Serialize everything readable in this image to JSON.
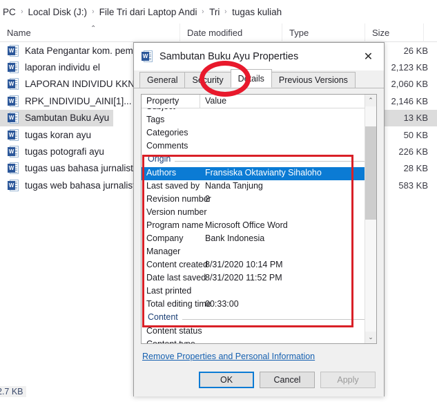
{
  "explorer": {
    "breadcrumb": {
      "items": [
        "PC",
        "Local Disk (J:)",
        "File Tri dari Laptop Andi",
        "Tri",
        "tugas kuliah"
      ],
      "separator": "›"
    },
    "columns": [
      {
        "label": "Name",
        "sort": "⌃"
      },
      {
        "label": "Date modified"
      },
      {
        "label": "Type"
      },
      {
        "label": "Size"
      }
    ],
    "files": [
      {
        "name": "Kata Pengantar kom. pemasaran",
        "size": "26 KB",
        "selected": false
      },
      {
        "name": "laporan individu el",
        "size": "2,123 KB",
        "selected": false
      },
      {
        "name": "LAPORAN INDIVIDU KKN INTEG",
        "size": "2,060 KB",
        "selected": false
      },
      {
        "name": "RPK_INDIVIDU_AINI[1]...",
        "size": "2,146 KB",
        "selected": false
      },
      {
        "name": "Sambutan Buku Ayu",
        "size": "13 KB",
        "selected": true
      },
      {
        "name": "tugas koran ayu",
        "size": "50 KB",
        "selected": false
      },
      {
        "name": "tugas potografi ayu",
        "size": "226 KB",
        "selected": false
      },
      {
        "name": "tugas uas bahasa jurnalistik ayu",
        "size": "28 KB",
        "selected": false
      },
      {
        "name": "tugas web bahasa jurnalistik",
        "size": "583 KB",
        "selected": false
      }
    ],
    "status": {
      "size": "2.7 KB"
    },
    "file_icon": "word-document-icon",
    "word_badge": "W"
  },
  "dialog": {
    "title": "Sambutan Buku Ayu Properties",
    "icon": "word-document-icon",
    "close_icon": "✕",
    "tabs": [
      {
        "label": "General",
        "active": false
      },
      {
        "label": "Security",
        "active": false
      },
      {
        "label": "Details",
        "active": true
      },
      {
        "label": "Previous Versions",
        "active": false
      }
    ],
    "list": {
      "headers": {
        "property": "Property",
        "value": "Value"
      },
      "rows": [
        {
          "kind": "clip-top",
          "name": "Subject",
          "value": ""
        },
        {
          "kind": "row",
          "name": "Tags",
          "value": ""
        },
        {
          "kind": "row",
          "name": "Categories",
          "value": ""
        },
        {
          "kind": "row",
          "name": "Comments",
          "value": ""
        },
        {
          "kind": "group",
          "name": "Origin",
          "value": ""
        },
        {
          "kind": "row",
          "name": "Authors",
          "value": "Fransiska Oktavianty Sihaloho",
          "selected": true
        },
        {
          "kind": "row",
          "name": "Last saved by",
          "value": "Nanda Tanjung"
        },
        {
          "kind": "row",
          "name": "Revision number",
          "value": "2"
        },
        {
          "kind": "row",
          "name": "Version number",
          "value": ""
        },
        {
          "kind": "row",
          "name": "Program name",
          "value": "Microsoft Office Word"
        },
        {
          "kind": "row",
          "name": "Company",
          "value": "Bank Indonesia"
        },
        {
          "kind": "row",
          "name": "Manager",
          "value": ""
        },
        {
          "kind": "row",
          "name": "Content created",
          "value": "8/31/2020 10:14 PM"
        },
        {
          "kind": "row",
          "name": "Date last saved",
          "value": "8/31/2020 11:52 PM"
        },
        {
          "kind": "row",
          "name": "Last printed",
          "value": ""
        },
        {
          "kind": "row",
          "name": "Total editing time",
          "value": "00:33:00"
        },
        {
          "kind": "group",
          "name": "Content",
          "value": ""
        },
        {
          "kind": "row",
          "name": "Content status",
          "value": ""
        },
        {
          "kind": "clip-bot",
          "name": "Content type",
          "value": ""
        }
      ],
      "scroll": {
        "up_icon": "⌃",
        "down_icon": "⌄"
      }
    },
    "remove_link": "Remove Properties and Personal Information",
    "buttons": [
      {
        "label": "OK",
        "state": "default"
      },
      {
        "label": "Cancel",
        "state": "normal"
      },
      {
        "label": "Apply",
        "state": "disabled"
      }
    ]
  },
  "annotations": {
    "ellipse": {
      "target": "Details",
      "color": "#e8192c"
    },
    "rect": {
      "target": "Origin",
      "color": "#d92027"
    }
  }
}
